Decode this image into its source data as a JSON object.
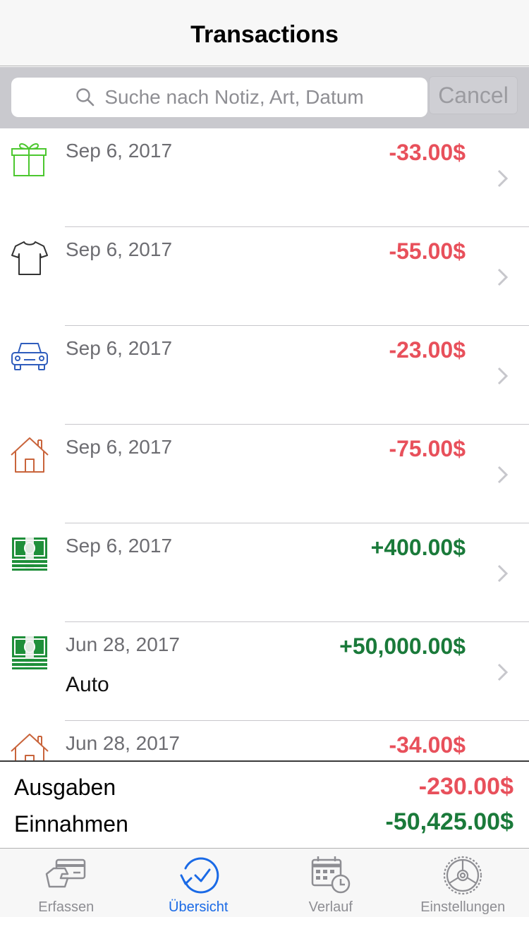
{
  "nav": {
    "title": "Transactions"
  },
  "search": {
    "placeholder": "Suche nach Notiz, Art, Datum",
    "cancel_label": "Cancel"
  },
  "transactions": [
    {
      "icon": "gift-icon",
      "date": "Sep 6, 2017",
      "note": "",
      "amount": "-33.00$",
      "type": "expense"
    },
    {
      "icon": "tshirt-icon",
      "date": "Sep 6, 2017",
      "note": "",
      "amount": "-55.00$",
      "type": "expense"
    },
    {
      "icon": "car-icon",
      "date": "Sep 6, 2017",
      "note": "",
      "amount": "-23.00$",
      "type": "expense"
    },
    {
      "icon": "house-icon",
      "date": "Sep 6, 2017",
      "note": "",
      "amount": "-75.00$",
      "type": "expense"
    },
    {
      "icon": "money-icon",
      "date": "Sep 6, 2017",
      "note": "",
      "amount": "+400.00$",
      "type": "income"
    },
    {
      "icon": "money-icon",
      "date": "Jun 28, 2017",
      "note": "Auto",
      "amount": "+50,000.00$",
      "type": "income"
    },
    {
      "icon": "house-icon",
      "date": "Jun 28, 2017",
      "note": "",
      "amount": "-34.00$",
      "type": "expense"
    }
  ],
  "summary": {
    "expenses_label": "Ausgaben",
    "expenses_value": "-230.00$",
    "income_label": "Einnahmen",
    "income_value": "-50,425.00$"
  },
  "tabs": [
    {
      "label": "Erfassen",
      "icon": "card-icon",
      "active": false
    },
    {
      "label": "Übersicht",
      "icon": "overview-clock-icon",
      "active": true
    },
    {
      "label": "Verlauf",
      "icon": "calendar-clock-icon",
      "active": false
    },
    {
      "label": "Einstellungen",
      "icon": "settings-gear-icon",
      "active": false
    }
  ],
  "colors": {
    "expense": "#e8505b",
    "income": "#1a7a3a",
    "accent": "#1a6ae6",
    "gift": "#4cc72f",
    "car": "#2f5dbd",
    "house": "#c9643b",
    "money": "#1f8f3a"
  }
}
